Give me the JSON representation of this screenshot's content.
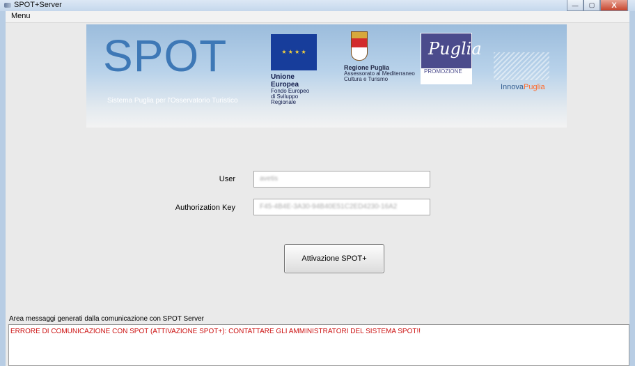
{
  "window": {
    "title": "SPOT+Server",
    "controls": {
      "minimize": "—",
      "maximize": "▢",
      "close": "X"
    }
  },
  "menubar": {
    "menu_label": "Menu"
  },
  "banner": {
    "spot_logo": "SPOT",
    "spot_subtitle": "Sistema Puglia per l'Osservatorio Turistico",
    "eu_title": "Unione Europea",
    "eu_sub1": "Fondo Europeo",
    "eu_sub2": "di Sviluppo Regionale",
    "regione_title": "Regione Puglia",
    "regione_sub1": "Assessorato al Mediterraneo",
    "regione_sub2": "Cultura e Turismo",
    "promo_script": "Puglia",
    "promo_word": "PROMOZIONE",
    "innova_prefix": "Innova",
    "innova_suffix": "Puglia"
  },
  "form": {
    "user_label": "User",
    "user_value": "avetis",
    "authkey_label": "Authorization Key",
    "authkey_value": "F45-4B4E-3A30-94B40E51C2ED4230-16A2"
  },
  "actions": {
    "activate_label": "Attivazione SPOT+"
  },
  "messages": {
    "label": "Area messaggi generati dalla comunicazione con SPOT Server",
    "error_text": "ERRORE DI COMUNICAZIONE CON SPOT (ATTIVAZIONE SPOT+): CONTATTARE GLI AMMINISTRATORI DEL SISTEMA SPOT!!"
  }
}
